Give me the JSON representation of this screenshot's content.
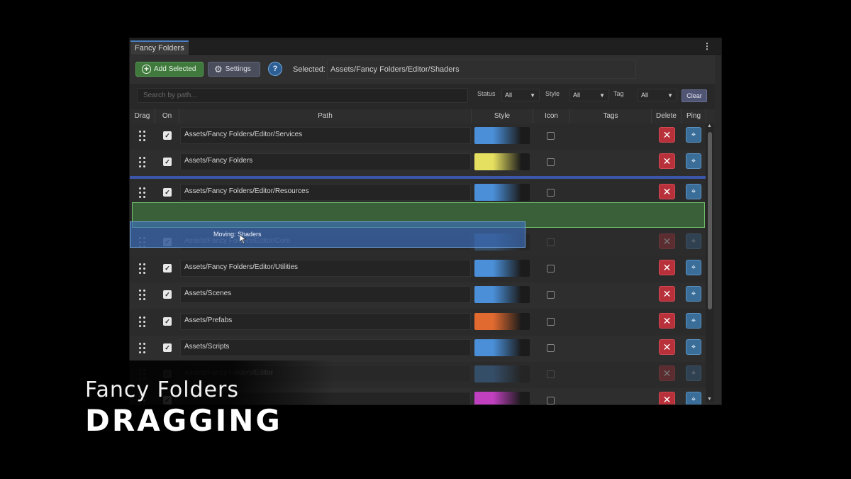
{
  "window": {
    "tab_title": "Fancy Folders",
    "menu_icon": "kebab-menu-icon"
  },
  "toolbar": {
    "add_selected_label": "Add Selected",
    "settings_label": "Settings",
    "help_label": "?",
    "selected_label": "Selected:",
    "selected_value": "Assets/Fancy Folders/Editor/Shaders"
  },
  "filters": {
    "search_placeholder": "Search by path...",
    "status_label": "Status",
    "status_value": "All",
    "style_label": "Style",
    "style_value": "All",
    "tag_label": "Tag",
    "tag_value": "All",
    "clear_label": "Clear"
  },
  "columns": [
    "Drag",
    "On",
    "Path",
    "Style",
    "Icon",
    "Tags",
    "Delete",
    "Ping"
  ],
  "rows": [
    {
      "path": "Assets/Fancy Folders/Editor/Services",
      "enabled": true,
      "color": "#4a8fd8"
    },
    {
      "path": "Assets/Fancy Folders",
      "enabled": true,
      "color": "#e6e060"
    },
    {
      "path": "Assets/Fancy Folders/Editor/Resources",
      "enabled": true,
      "color": "#4a8fd8"
    },
    {
      "path": "Assets/Fancy Folders/Editor/Core",
      "enabled": true,
      "color": "#4a8fd8"
    },
    {
      "path": "Assets/Fancy Folders/Editor/Utilities",
      "enabled": true,
      "color": "#4a8fd8"
    },
    {
      "path": "Assets/Scenes",
      "enabled": true,
      "color": "#4a8fd8"
    },
    {
      "path": "Assets/Prefabs",
      "enabled": true,
      "color": "#e06a30"
    },
    {
      "path": "Assets/Scripts",
      "enabled": true,
      "color": "#4a8fd8"
    },
    {
      "path": "Assets/Fancy Folders/Editor",
      "enabled": true,
      "color": "#4a8fd8"
    },
    {
      "path": "",
      "enabled": true,
      "color": "#c040c0"
    }
  ],
  "drag": {
    "ghost_label": "Moving: Shaders"
  },
  "caption": {
    "line1": "Fancy Folders",
    "line2": "DRAGGING"
  }
}
